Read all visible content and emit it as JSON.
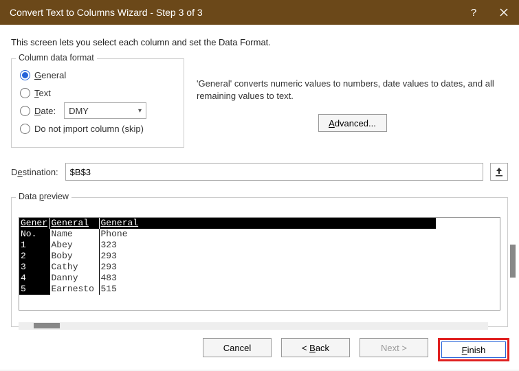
{
  "titlebar": {
    "title": "Convert Text to Columns Wizard - Step 3 of 3"
  },
  "instruction": "This screen lets you select each column and set the Data Format.",
  "format_group": {
    "legend": "Column data format",
    "general": "General",
    "text": "Text",
    "date": "Date:",
    "date_value": "DMY",
    "skip": "Do not import column (skip)"
  },
  "desc": "'General' converts numeric values to numbers, date values to dates, and all remaining values to text.",
  "advanced": "Advanced...",
  "destination": {
    "label": "Destination:",
    "value": "$B$3"
  },
  "preview": {
    "legend": "Data preview",
    "headers": [
      "General",
      "General",
      "General"
    ],
    "rows": [
      [
        "No.",
        "Name",
        "Phone"
      ],
      [
        "1",
        "Abey",
        "323"
      ],
      [
        "2",
        "Boby",
        "293"
      ],
      [
        "3",
        "Cathy",
        "293"
      ],
      [
        "4",
        "Danny",
        "483"
      ],
      [
        "5",
        "Earnesto",
        "515"
      ]
    ]
  },
  "buttons": {
    "cancel": "Cancel",
    "back": "< Back",
    "next": "Next >",
    "finish": "Finish"
  }
}
